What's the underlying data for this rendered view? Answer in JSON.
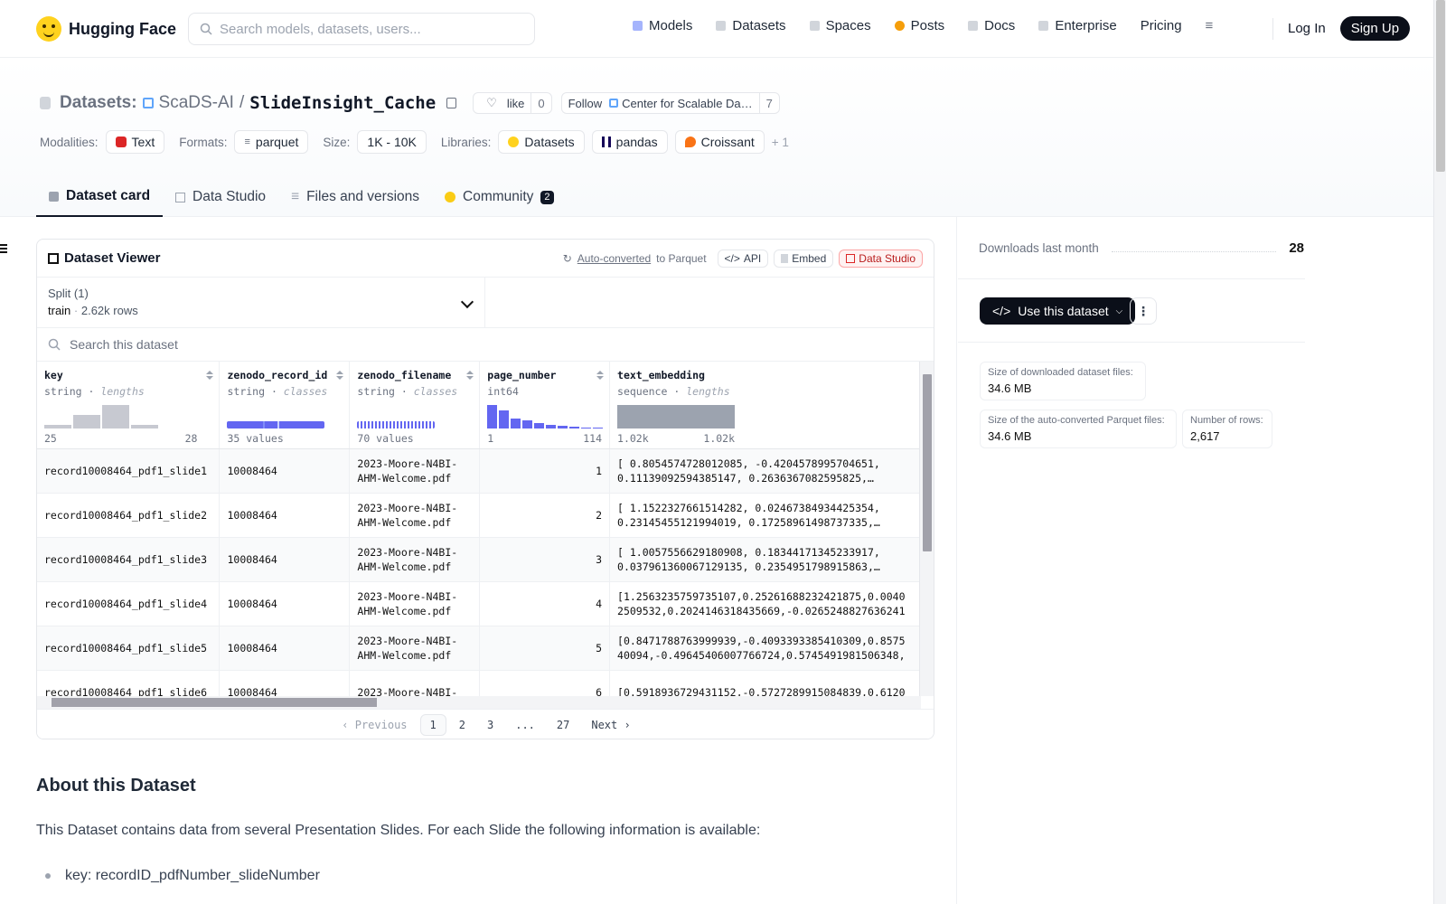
{
  "header": {
    "logo_text": "Hugging Face",
    "search_placeholder": "Search models, datasets, users...",
    "nav": [
      {
        "label": "Models",
        "icon": "models-icon",
        "color": "#a78bfa"
      },
      {
        "label": "Datasets",
        "icon": "datasets-icon",
        "color": "#9ca3af"
      },
      {
        "label": "Spaces",
        "icon": "spaces-icon",
        "color": "#9ca3af"
      },
      {
        "label": "Posts",
        "icon": "posts-icon",
        "color": "#f59e0b"
      },
      {
        "label": "Docs",
        "icon": "docs-icon",
        "color": "#9ca3af"
      },
      {
        "label": "Enterprise",
        "icon": "enterprise-icon",
        "color": "#9ca3af"
      },
      {
        "label": "Pricing",
        "icon": "",
        "color": ""
      }
    ],
    "login": "Log In",
    "signup": "Sign Up"
  },
  "repo": {
    "type_label": "Datasets:",
    "org": "ScaDS-AI",
    "separator": "/",
    "name": "SlideInsight_Cache",
    "like_label": "like",
    "like_count": "0",
    "follow_label": "Follow",
    "follow_org": "Center for Scalable Da…",
    "follow_count": "7"
  },
  "meta": {
    "modalities_label": "Modalities:",
    "modality": "Text",
    "formats_label": "Formats:",
    "format": "parquet",
    "size_label": "Size:",
    "size": "1K - 10K",
    "libraries_label": "Libraries:",
    "libraries": [
      "Datasets",
      "pandas",
      "Croissant"
    ],
    "more": "+ 1"
  },
  "tabs": [
    {
      "label": "Dataset card",
      "active": true
    },
    {
      "label": "Data Studio",
      "active": false
    },
    {
      "label": "Files and versions",
      "active": false
    },
    {
      "label": "Community",
      "active": false,
      "badge": "2"
    }
  ],
  "viewer": {
    "title": "Dataset Viewer",
    "auto_converted": "Auto-converted",
    "to_parquet": "to Parquet",
    "api": "API",
    "embed": "Embed",
    "data_studio": "Data Studio",
    "split_label": "Split (1)",
    "split_name": "train",
    "split_rows": "2.62k rows",
    "search_placeholder": "Search this dataset",
    "columns": [
      {
        "name": "key",
        "type": "string",
        "stat": "lengths",
        "min": "25",
        "max": "28"
      },
      {
        "name": "zenodo_record_id",
        "type": "string",
        "stat": "classes",
        "caption": "35 values"
      },
      {
        "name": "zenodo_filename",
        "type": "string",
        "stat": "classes",
        "caption": "70 values"
      },
      {
        "name": "page_number",
        "type": "int64",
        "stat": "",
        "min": "1",
        "max": "114"
      },
      {
        "name": "text_embedding",
        "type": "sequence",
        "stat": "lengths",
        "min": "1.02k",
        "max": "1.02k"
      }
    ],
    "rows": [
      {
        "key": "record10008464_pdf1_slide1",
        "record": "10008464",
        "file": "2023-Moore-N4BI-AHM-Welcome.pdf",
        "page": "1",
        "emb": "[ 0.8054574728012085, -0.4204578995704651, 0.11139092594385147, 0.2636367082595825,…"
      },
      {
        "key": "record10008464_pdf1_slide2",
        "record": "10008464",
        "file": "2023-Moore-N4BI-AHM-Welcome.pdf",
        "page": "2",
        "emb": "[ 1.1522327661514282, 0.02467384934425354, 0.23145455121994019, 0.17258961498737335,…"
      },
      {
        "key": "record10008464_pdf1_slide3",
        "record": "10008464",
        "file": "2023-Moore-N4BI-AHM-Welcome.pdf",
        "page": "3",
        "emb": "[ 1.0057556629180908, 0.18344171345233917, 0.037961360067129135, 0.2354951798915863,…"
      },
      {
        "key": "record10008464_pdf1_slide4",
        "record": "10008464",
        "file": "2023-Moore-N4BI-AHM-Welcome.pdf",
        "page": "4",
        "emb": "[1.2563235759735107,0.25261688232421875,0.0040 2509532,0.2024146318435669,-0.0265248827636241"
      },
      {
        "key": "record10008464_pdf1_slide5",
        "record": "10008464",
        "file": "2023-Moore-N4BI-AHM-Welcome.pdf",
        "page": "5",
        "emb": "[0.8471788763999939,-0.4093393385410309,0.8575 40094,-0.49645406007766724,0.5745491981506348,"
      },
      {
        "key": "record10008464_pdf1_slide6",
        "record": "10008464",
        "file": "2023-Moore-N4BI-",
        "page": "6",
        "emb": "[0.5918936729431152,-0.5727289915084839,0.6120"
      }
    ],
    "pager": {
      "prev": "Previous",
      "pages": [
        "1",
        "2",
        "3",
        "...",
        "27"
      ],
      "next": "Next",
      "current": "1"
    }
  },
  "about": {
    "heading": "About this Dataset",
    "intro": "This Dataset contains data from several Presentation Slides. For each Slide the following information is available:",
    "first_item": "key: recordID_pdfNumber_slideNumber"
  },
  "sidebar": {
    "downloads_label": "Downloads last month",
    "downloads_value": "28",
    "use_button": "Use this dataset",
    "downloaded_size_label": "Size of downloaded dataset files:",
    "downloaded_size": "34.6 MB",
    "parquet_size_label": "Size of the auto-converted Parquet files:",
    "parquet_size": "34.6 MB",
    "rows_label": "Number of rows:",
    "rows_value": "2,617"
  }
}
